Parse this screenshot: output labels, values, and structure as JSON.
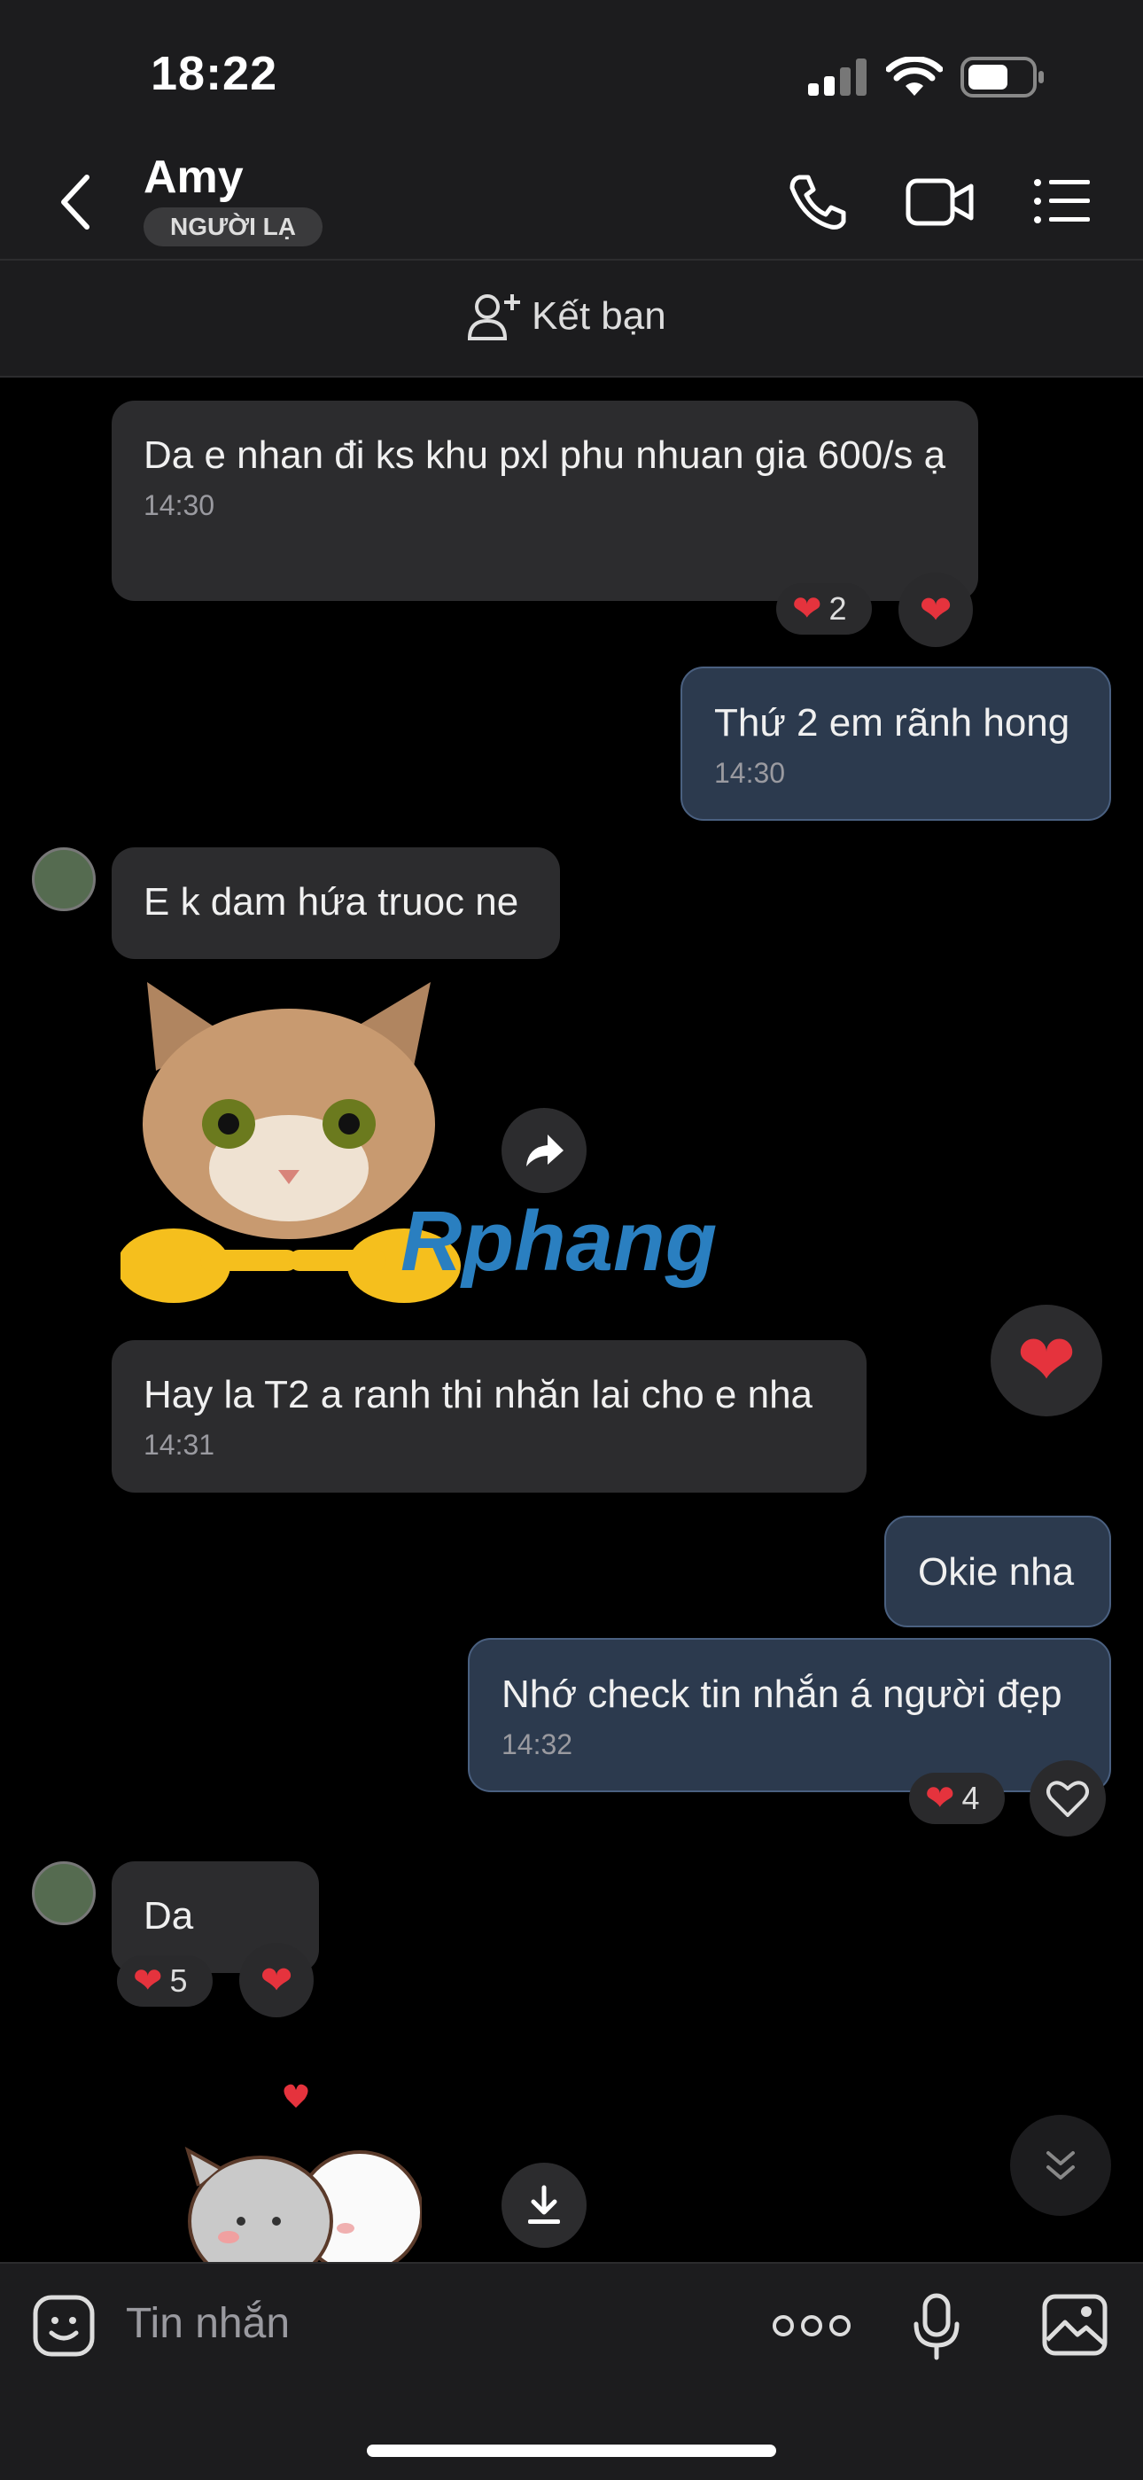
{
  "status_bar": {
    "time": "18:22"
  },
  "header": {
    "contact_name": "Amy",
    "badge": "NGƯỜI LẠ",
    "add_friend_label": "Kết bạn"
  },
  "messages": {
    "m1": {
      "text": "Da e nhan đi ks khu pxl phu nhuan gia 600/s ạ",
      "time": "14:30",
      "reaction_count": "2"
    },
    "m2": {
      "text": "Thứ 2 em rãnh hong",
      "time": "14:30"
    },
    "m3": {
      "text": "E k dam hứa truoc ne"
    },
    "sticker1": {
      "watermark": "Rphang"
    },
    "m4": {
      "text": "Hay la T2 a ranh thi nhăn lai cho e nha",
      "time": "14:31"
    },
    "m5": {
      "text": "Okie nha"
    },
    "m6": {
      "text": "Nhớ check tin nhắn á người đẹp",
      "time": "14:32",
      "reaction_count": "4"
    },
    "m7": {
      "text": "Da",
      "reaction_count": "5"
    }
  },
  "input": {
    "placeholder": "Tin nhắn"
  },
  "colors": {
    "heart": "#e5333d",
    "bubble_incoming": "#2c2c2e",
    "bubble_outgoing": "#2c3a4e"
  }
}
